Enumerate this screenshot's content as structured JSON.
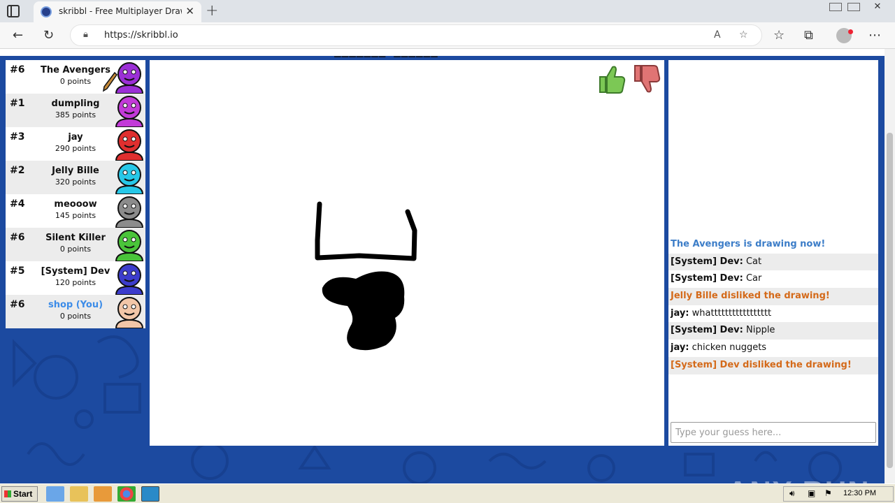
{
  "browser": {
    "tab_title": "skribbl - Free Multiplayer Drawing",
    "url": "https://skribbl.io"
  },
  "game": {
    "word_hint": "_______ ______"
  },
  "players": [
    {
      "rank": "#6",
      "name": "The Avengers",
      "points": "0 points",
      "color": "#9b2fd6",
      "drawing": true
    },
    {
      "rank": "#1",
      "name": "dumpling",
      "points": "385 points",
      "color": "#c23ad8"
    },
    {
      "rank": "#3",
      "name": "jay",
      "points": "290 points",
      "color": "#e02f2f"
    },
    {
      "rank": "#2",
      "name": "Jelly Bille",
      "points": "320 points",
      "color": "#27c8e8"
    },
    {
      "rank": "#4",
      "name": "meooow",
      "points": "145 points",
      "color": "#8c8c8c"
    },
    {
      "rank": "#6",
      "name": "Silent Killer",
      "points": "0 points",
      "color": "#4ac43a"
    },
    {
      "rank": "#5",
      "name": "[System] Dev",
      "points": "120 points",
      "color": "#3c3ccc"
    },
    {
      "rank": "#6",
      "name": "shop (You)",
      "points": "0 points",
      "color": "#f2c6a8",
      "you": true
    }
  ],
  "chat": {
    "messages": [
      {
        "style": "blue",
        "sender": "",
        "text": "The Avengers is drawing now!"
      },
      {
        "style": "normal",
        "sender": "[System] Dev:",
        "text": " Cat"
      },
      {
        "style": "normal",
        "sender": "[System] Dev:",
        "text": " Car"
      },
      {
        "style": "orange",
        "sender": "",
        "text": "Jelly Bille disliked the drawing!"
      },
      {
        "style": "normal",
        "sender": "jay:",
        "text": " whattttttttttttttttt"
      },
      {
        "style": "normal",
        "sender": "[System] Dev:",
        "text": " Nipple"
      },
      {
        "style": "normal",
        "sender": "jay:",
        "text": " chicken nuggets"
      },
      {
        "style": "orange",
        "sender": "",
        "text": "[System] Dev disliked the drawing!"
      }
    ],
    "input_placeholder": "Type your guess here..."
  },
  "watermark": "ANY RUN",
  "taskbar": {
    "start_label": "Start",
    "clock": "12:30 PM"
  },
  "colors": {
    "page_bg": "#1c4aa0",
    "system_blue": "#3c7dc8",
    "dislike_orange": "#d46a1a",
    "you_blue": "#3c8ce8"
  }
}
